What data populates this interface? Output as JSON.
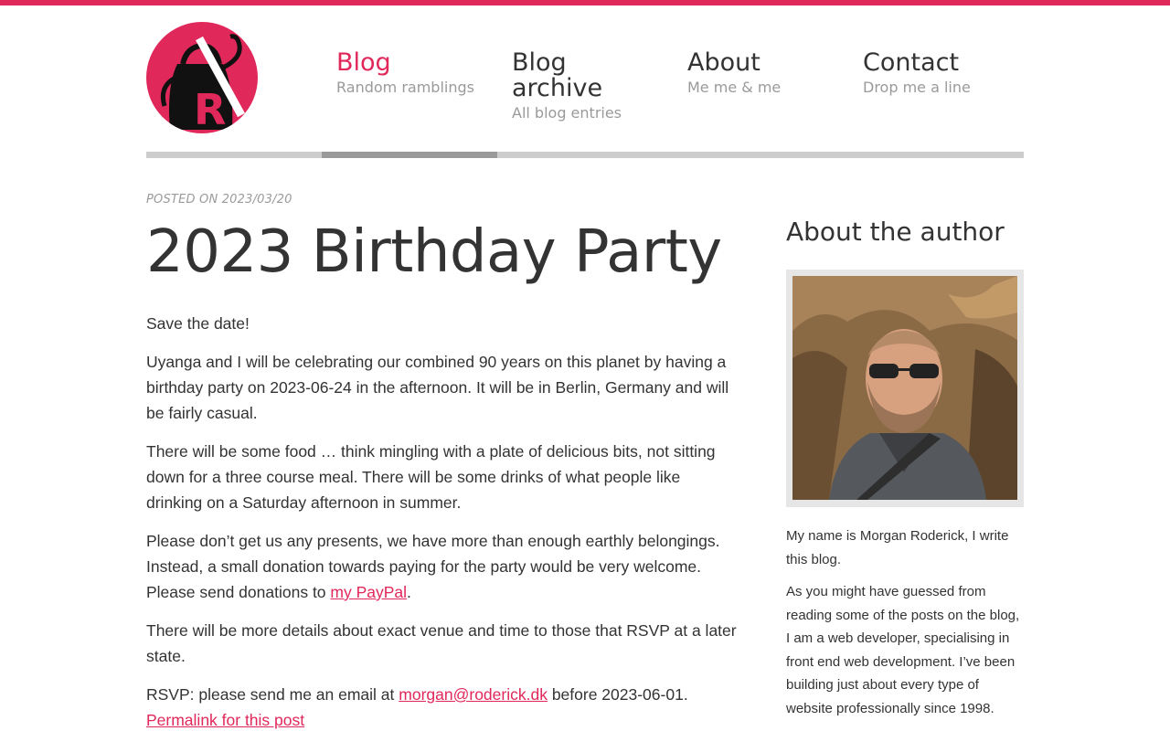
{
  "colors": {
    "accent": "#e0285a",
    "text": "#333333",
    "muted": "#9a9a9a"
  },
  "logo": {
    "icon": "kettle-r-logo-icon"
  },
  "nav": {
    "items": [
      {
        "title": "Blog",
        "subtitle": "Random ramblings",
        "active": true
      },
      {
        "title": "Blog archive",
        "subtitle": "All blog entries",
        "active": false
      },
      {
        "title": "About",
        "subtitle": "Me me & me",
        "active": false
      },
      {
        "title": "Contact",
        "subtitle": "Drop me a line",
        "active": false
      }
    ]
  },
  "post": {
    "posted_on": "POSTED ON 2023/03/20",
    "title": "2023 Birthday Party",
    "p1": "Save the date!",
    "p2": "Uyanga and I will be celebrating our combined 90 years on this planet by having a birthday party on 2023-06-24 in the afternoon. It will be in Berlin, Germany and will be fairly casual.",
    "p3": "There will be some food … think mingling with a plate of delicious bits, not sitting down for a three course meal. There will be some drinks of what people like drinking on a Saturday afternoon in summer.",
    "p4_before": "Please don’t get us any presents, we have more than enough earthly belongings. Instead, a small donation towards paying for the party would be very welcome. Please send donations to ",
    "p4_link": "my PayPal",
    "p4_after": ".",
    "p5": "There will be more details about exact venue and time to those that RSVP at a later state.",
    "p6_before": "RSVP: please send me an email at ",
    "p6_link": "morgan@roderick.dk",
    "p6_after": " before 2023-06-01.",
    "permalink": "Permalink for this post"
  },
  "sidebar": {
    "heading": "About the author",
    "photo_icon": "author-photo",
    "p1": "My name is Morgan Roderick, I write this blog.",
    "p2": "As you might have guessed from reading some of the posts on the blog, I am a web developer, specialising in front end web development. I’ve been building just about every type of website professionally since 1998."
  }
}
